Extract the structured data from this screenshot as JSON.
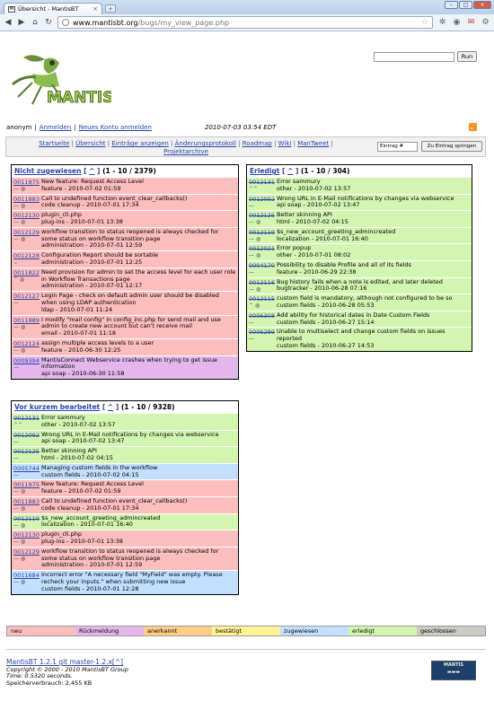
{
  "browser": {
    "tab_title": "Übersicht - MantisBT",
    "url_host": "www.mantisbt.org",
    "url_path": "/bugs/my_view_page.php"
  },
  "header": {
    "logo_text": "MANTIS",
    "run_label": "Run",
    "user": "anonym",
    "login_link": "Anmelden",
    "signup_link": "Neues Konto anmelden",
    "datetime": "2010-07-03 03:54 EDT"
  },
  "menu": {
    "items": [
      "Startseite",
      "Übersicht",
      "Einträge anzeigen",
      "Änderungsprotokoll",
      "Roadmap",
      "Wiki",
      "ManTweet",
      "Projektarchive"
    ],
    "jump_placeholder": "Eintrag #",
    "jump_button": "Zu Eintrag springen"
  },
  "boxes": {
    "unassigned": {
      "title": "Nicht zugewiesen",
      "caret": "^",
      "count": "(1 - 10 / 2379)",
      "rows": [
        {
          "id": "0011975",
          "text": "New feature: Request Access Level",
          "meta": "feature - 2010-07-02 01:59",
          "icons": "— ◍",
          "status": "new",
          "strike": false
        },
        {
          "id": "0011883",
          "text": "Call to undefined function event_clear_callbacks()",
          "meta": "code cleanup - 2010-07-01 17:34",
          "icons": "— ◍",
          "status": "new",
          "strike": false
        },
        {
          "id": "0012130",
          "text": "plugin_cli.php",
          "meta": "plug-ins - 2010-07-01 13:38",
          "icons": "— ◍",
          "status": "new",
          "strike": false
        },
        {
          "id": "0012129",
          "text": "workflow transition to status reopened is always checked for some status on workflow transition page",
          "meta": "administration - 2010-07-01 12:59",
          "icons": "— ◍",
          "status": "new",
          "strike": false
        },
        {
          "id": "0012128",
          "text": "Configuration Report should be sortable",
          "meta": "administration - 2010-07-01 12:25",
          "icons": "⌄",
          "status": "new",
          "strike": false
        },
        {
          "id": "0011822",
          "text": "Need provision for admin to set the access level for each user role in Workflow Transactions page",
          "meta": "administration - 2010-07-01 12:17",
          "icons": "^ ◍",
          "status": "new",
          "strike": false
        },
        {
          "id": "0012127",
          "text": "Login Page - check on default admin user should be disabled when using LDAP authentication",
          "meta": "ldap - 2010-07-01 11:24",
          "icons": "—",
          "status": "new",
          "strike": false
        },
        {
          "id": "0011989",
          "text": "I modify \"mail config\" in config_inc.php for send mail and use admin to create new account but can't receive mail",
          "meta": "email - 2010-07-01 11:18",
          "icons": "— ◍",
          "status": "new",
          "strike": false
        },
        {
          "id": "0012124",
          "text": "assign multiple access levels to a user",
          "meta": "feature - 2010-06-30 12:25",
          "icons": "— ◍",
          "status": "new",
          "strike": false
        },
        {
          "id": "0009394",
          "text": "MantisConnect Webservice crashes when trying to get issue information",
          "meta": "api soap - 2010-06-30 11:58",
          "icons": "—",
          "status": "feedback",
          "strike": false
        }
      ]
    },
    "resolved": {
      "title": "Erledigt",
      "caret": "^",
      "count": "(1 - 10 / 304)",
      "rows": [
        {
          "id": "0012131",
          "text": "Error sammury",
          "meta": "other - 2010-07-02 13:57",
          "icons": "⌃⌃",
          "status": "resolved",
          "strike": true
        },
        {
          "id": "0012092",
          "text": "Wrong URL in E-Mail notifications by changes via webservice",
          "meta": "api soap - 2010-07-02 13:47",
          "icons": "—",
          "status": "resolved",
          "strike": true
        },
        {
          "id": "0012125",
          "text": "Better skinning API",
          "meta": "html - 2010-07-02 04:15",
          "icons": "— ◍",
          "status": "resolved",
          "strike": true
        },
        {
          "id": "0012119",
          "text": "$s_new_account_greeting_admincreated",
          "meta": "localization - 2010-07-01 16:40",
          "icons": "— ◍",
          "status": "resolved",
          "strike": true
        },
        {
          "id": "0012021",
          "text": "Error popup",
          "meta": "other - 2010-07-01 08:02",
          "icons": "— ◍",
          "status": "resolved",
          "strike": true
        },
        {
          "id": "0004170",
          "text": "Possibility to disable Profile and all of its fields",
          "meta": "feature - 2010-06-29 22:38",
          "icons": "—",
          "status": "resolved",
          "strike": true
        },
        {
          "id": "0012116",
          "text": "Bug history fails when a note is edited, and later deleted",
          "meta": "bugtracker - 2010-06-28 07:16",
          "icons": "— ◍",
          "status": "resolved",
          "strike": true
        },
        {
          "id": "0012115",
          "text": "custom field is mandatory, although not configured to be so",
          "meta": "custom fields - 2010-06-28 05:53",
          "icons": "⌃ ◍",
          "status": "resolved",
          "strike": true
        },
        {
          "id": "0006308",
          "text": "Add ability for historical dates in Date Custom Fields",
          "meta": "custom fields - 2010-06-27 15:14",
          "icons": "—",
          "status": "resolved",
          "strike": true
        },
        {
          "id": "0006289",
          "text": "Unable to multiselect and change custom fields on issues reported",
          "meta": "custom fields - 2010-06-27 14:53",
          "icons": "—",
          "status": "resolved",
          "strike": true
        }
      ]
    },
    "recent": {
      "title": "Vor kurzem bearbeitet",
      "caret": "^",
      "count": "(1 - 10 / 9328)",
      "rows": [
        {
          "id": "0012131",
          "text": "Error sammury",
          "meta": "other - 2010-07-02 13:57",
          "icons": "⌃⌃",
          "status": "resolved",
          "strike": true
        },
        {
          "id": "0012092",
          "text": "Wrong URL in E-Mail notifications by changes via webservice",
          "meta": "api soap - 2010-07-02 13:47",
          "icons": "—",
          "status": "resolved",
          "strike": true
        },
        {
          "id": "0012125",
          "text": "Better skinning API",
          "meta": "html - 2010-07-02 04:15",
          "icons": "—",
          "status": "resolved",
          "strike": true
        },
        {
          "id": "0005744",
          "text": "Managing custom fields in the workflow",
          "meta": "custom fields - 2010-07-02 04:15",
          "icons": "—",
          "status": "assigned",
          "strike": false
        },
        {
          "id": "0011975",
          "text": "New feature: Request Access Level",
          "meta": "feature - 2010-07-02 01:59",
          "icons": "— ◍",
          "status": "new",
          "strike": false
        },
        {
          "id": "0011883",
          "text": "Call to undefined function event_clear_callbacks()",
          "meta": "code cleanup - 2010-07-01 17:34",
          "icons": "— ◍",
          "status": "new",
          "strike": false
        },
        {
          "id": "0012119",
          "text": "$s_new_account_greeting_admincreated",
          "meta": "localization - 2010-07-01 16:40",
          "icons": "— ◍",
          "status": "resolved",
          "strike": true
        },
        {
          "id": "0012130",
          "text": "plugin_cli.php",
          "meta": "plug-ins - 2010-07-01 13:38",
          "icons": "— ◍",
          "status": "new",
          "strike": false
        },
        {
          "id": "0012129",
          "text": "workflow transition to status reopened is always checked for some status on workflow transition page",
          "meta": "administration - 2010-07-01 12:59",
          "icons": "— ◍",
          "status": "new",
          "strike": false
        },
        {
          "id": "0011684",
          "text": "Incorrect error \"A necessary field \"MyField\" was empty. Please recheck your inputs.\" when submitting new issue",
          "meta": "custom fields - 2010-07-01 12:28",
          "icons": "— ◍",
          "status": "assigned",
          "strike": false
        }
      ]
    }
  },
  "legend": [
    {
      "label": "neu",
      "status": "new"
    },
    {
      "label": "Rückmeldung",
      "status": "feedback"
    },
    {
      "label": "anerkannt",
      "status": "ack"
    },
    {
      "label": "bestätigt",
      "status": "confirmed"
    },
    {
      "label": "zugewiesen",
      "status": "assigned"
    },
    {
      "label": "erledigt",
      "status": "resolved"
    },
    {
      "label": "geschlossen",
      "status": "closed"
    }
  ],
  "footer": {
    "version_link": "MantisBT 1.2.1 git master-1.2.x[^]",
    "copyright": "Copyright © 2000 - 2010 MantisBT Group",
    "time": "Time: 0.5320 seconds.",
    "memory": "Speicherverbrauch: 2,455 KB",
    "logo_text": "MANTIS"
  },
  "colors": {
    "new": "#fcbdbd",
    "feedback": "#e3b7eb",
    "ack": "#ffcd85",
    "confirmed": "#fff494",
    "assigned": "#c2dfff",
    "resolved": "#d2f5b0",
    "closed": "#c9ccc4",
    "link": "#2b45a7"
  }
}
